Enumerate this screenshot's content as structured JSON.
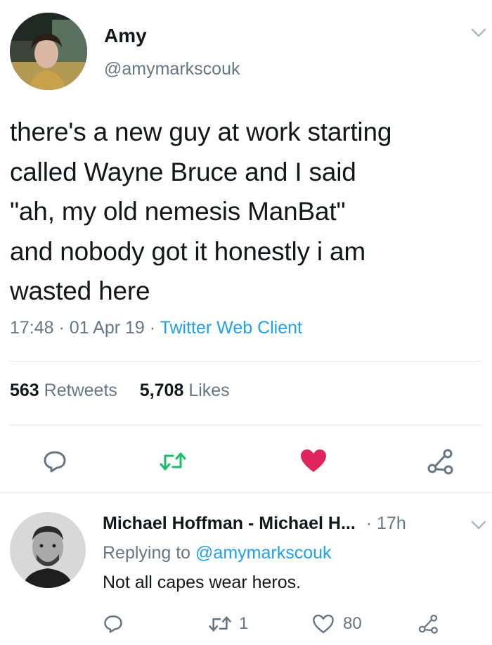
{
  "tweet": {
    "author_name": "Amy",
    "author_handle": "@amymarkscouk",
    "text_lines": [
      "there's a new guy at work starting",
      "called Wayne Bruce and I said",
      "\"ah, my old nemesis ManBat\"",
      "and nobody got it honestly i am",
      "wasted here"
    ],
    "time": "17:48",
    "date": "01 Apr 19",
    "dot": "·",
    "client": "Twitter Web Client",
    "retweet_count": "563",
    "retweet_label": "Retweets",
    "like_count": "5,708",
    "like_label": "Likes"
  },
  "reply": {
    "author_name": "Michael Hoffman - Michael H...",
    "dot": "·",
    "time": "17h",
    "replying_prefix": "Replying to",
    "replying_handle": "@amymarkscouk",
    "text": "Not all capes wear heros.",
    "retweet_count": "1",
    "like_count": "80"
  },
  "icons": {
    "reply": "reply-icon",
    "retweet": "retweet-icon",
    "like": "heart-icon",
    "share": "share-icon",
    "menu": "chevron-down-icon"
  },
  "colors": {
    "text": "#14171a",
    "muted": "#657786",
    "link": "#1da1f2",
    "retweet_active": "#17bf63",
    "like_active": "#e0245e",
    "divider": "#e1e8ed"
  }
}
